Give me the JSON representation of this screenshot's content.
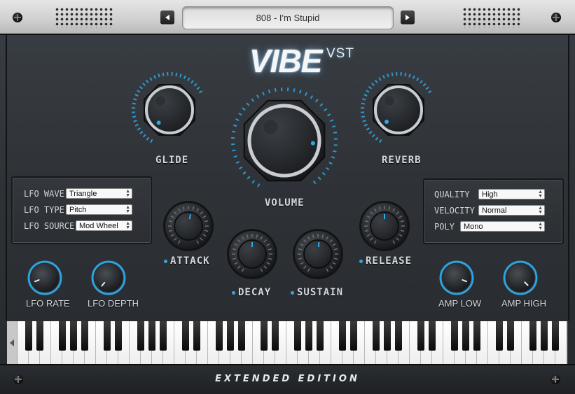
{
  "preset": {
    "name": "808 - I'm Stupid"
  },
  "logo": {
    "main": "VIBE",
    "sub": "VST"
  },
  "knobs": {
    "glide": "GLIDE",
    "volume": "VOLUME",
    "reverb": "REVERB",
    "attack": "ATTACK",
    "decay": "DECAY",
    "sustain": "SUSTAIN",
    "release": "RELEASE",
    "lfo_rate": "LFO RATE",
    "lfo_depth": "LFO DEPTH",
    "amp_low": "AMP LOW",
    "amp_high": "AMP HIGH"
  },
  "lfo_panel": {
    "wave_label": "LFO WAVE",
    "wave_value": "Triangle",
    "type_label": "LFO TYPE",
    "type_value": "Pitch",
    "source_label": "LFO SOURCE",
    "source_value": "Mod Wheel"
  },
  "settings_panel": {
    "quality_label": "QUALITY",
    "quality_value": "High",
    "velocity_label": "VELOCITY",
    "velocity_value": "Normal",
    "poly_label": "POLY",
    "poly_value": "Mono"
  },
  "footer": {
    "edition": "EXTENDED EDITION"
  },
  "colors": {
    "accent": "#2fa8e6",
    "panel": "#2f3338",
    "label": "#d4d8dc"
  },
  "icons": {
    "prev": "chevron-left-icon",
    "next": "chevron-right-icon",
    "scroll": "chevron-left-icon"
  }
}
